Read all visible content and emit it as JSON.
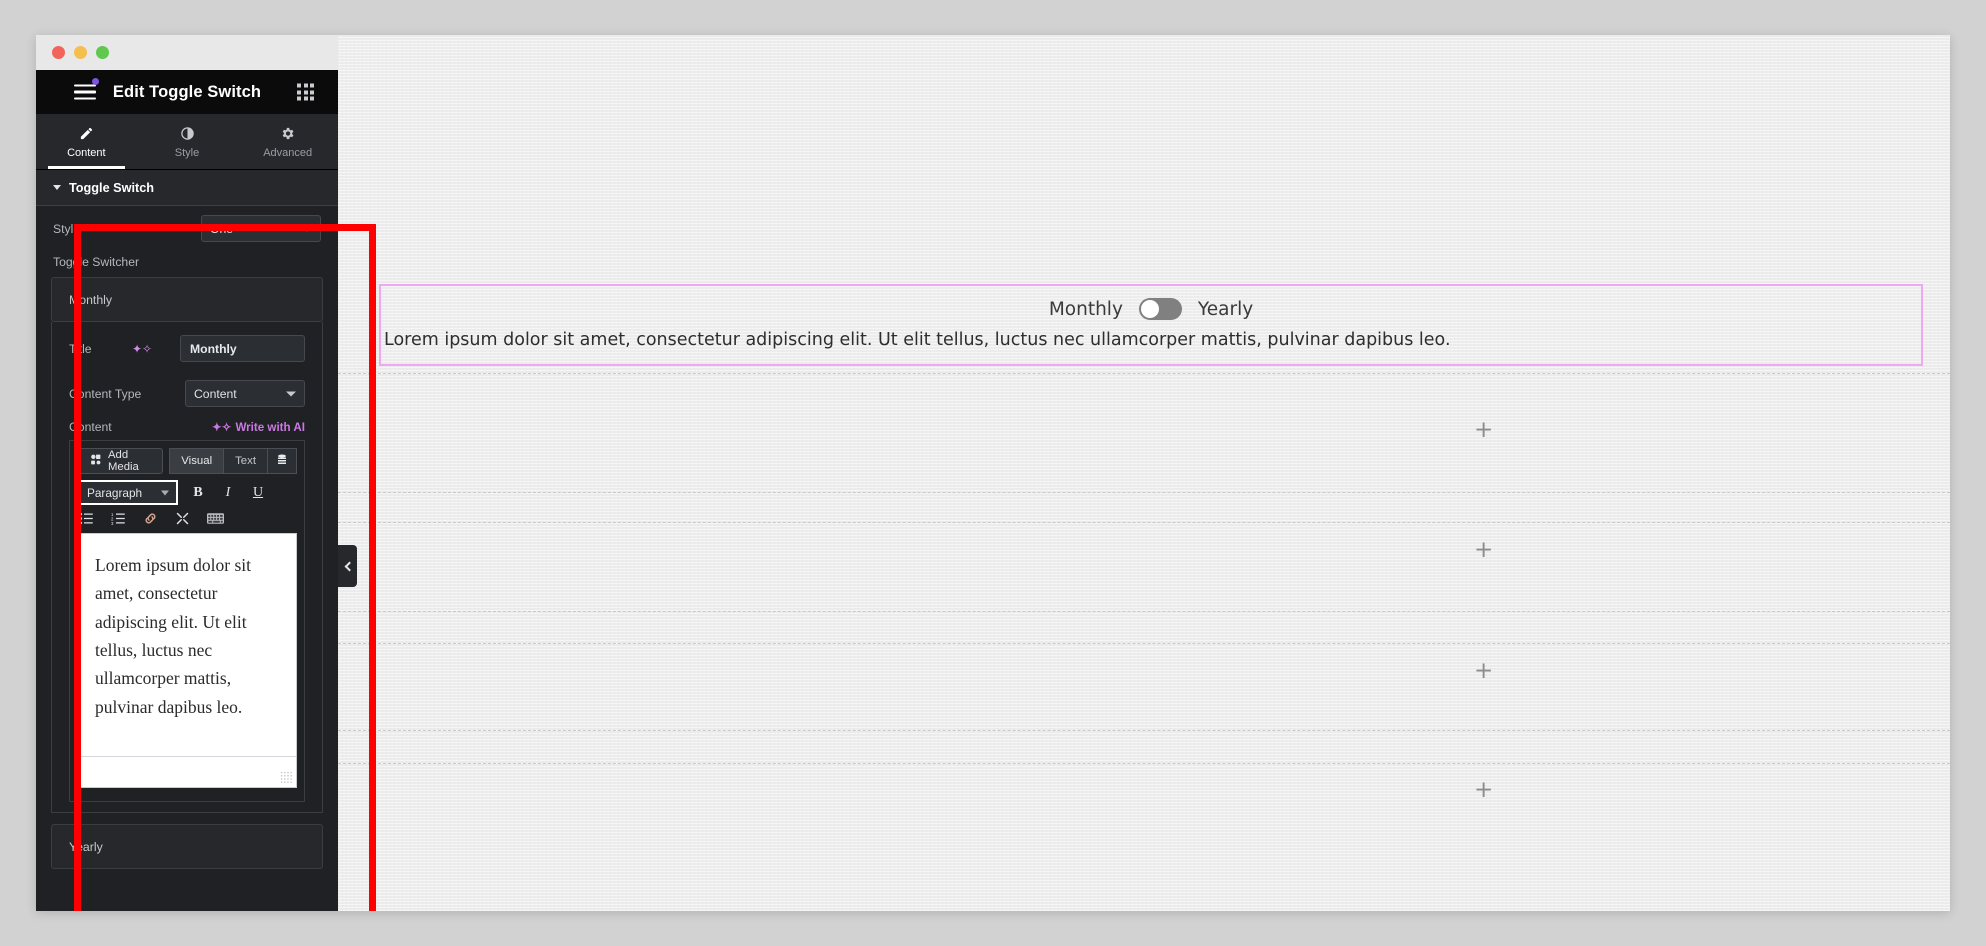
{
  "window": {
    "traffic_lights": [
      "close",
      "minimize",
      "maximize"
    ]
  },
  "panel": {
    "title": "Edit Toggle Switch",
    "menu_icon": "hamburger-icon",
    "grid_icon": "grid-icon",
    "tabs": [
      {
        "label": "Content",
        "icon": "pencil-icon",
        "active": true
      },
      {
        "label": "Style",
        "icon": "contrast-icon",
        "active": false
      },
      {
        "label": "Advanced",
        "icon": "gear-icon",
        "active": false
      }
    ],
    "section": {
      "title": "Toggle Switch",
      "controls": {
        "style_label": "Style",
        "style_value": "One",
        "toggle_switcher_label": "Toggle Switcher",
        "repeater_items": [
          {
            "label": "Monthly"
          },
          {
            "label": "Yearly"
          }
        ],
        "title_label": "Title",
        "title_value": "Monthly",
        "content_type_label": "Content Type",
        "content_type_value": "Content",
        "content_label": "Content",
        "write_with_ai": "Write with AI"
      },
      "editor": {
        "add_media": "Add Media",
        "tab_visual": "Visual",
        "tab_text": "Text",
        "tab_icon": "database-icon",
        "format_select": "Paragraph",
        "bold": "B",
        "italic": "I",
        "underline": "U",
        "buttons": [
          "bulleted-list-icon",
          "numbered-list-icon",
          "link-icon",
          "fullscreen-icon",
          "keyboard-icon"
        ],
        "body_text": "Lorem ipsum dolor sit amet, consectetur adipiscing elit. Ut elit tellus, luctus nec ullamcorper mattis, pulvinar dapibus leo."
      }
    }
  },
  "canvas": {
    "collapse_handle": "chevron-left-icon",
    "widget": {
      "left_label": "Monthly",
      "right_label": "Yearly",
      "switch_state": "off",
      "paragraph": "Lorem ipsum dolor sit amet, consectetur adipiscing elit. Ut elit tellus, luctus nec ullamcorper mattis, pulvinar dapibus leo."
    },
    "add_buttons": [
      "+",
      "+",
      "+",
      "+"
    ]
  },
  "colors": {
    "highlight_red": "#ff0000",
    "widget_outline_pink": "#f0a8f0",
    "ai_purple": "#c97ae0",
    "badge_purple": "#7f54e0"
  }
}
